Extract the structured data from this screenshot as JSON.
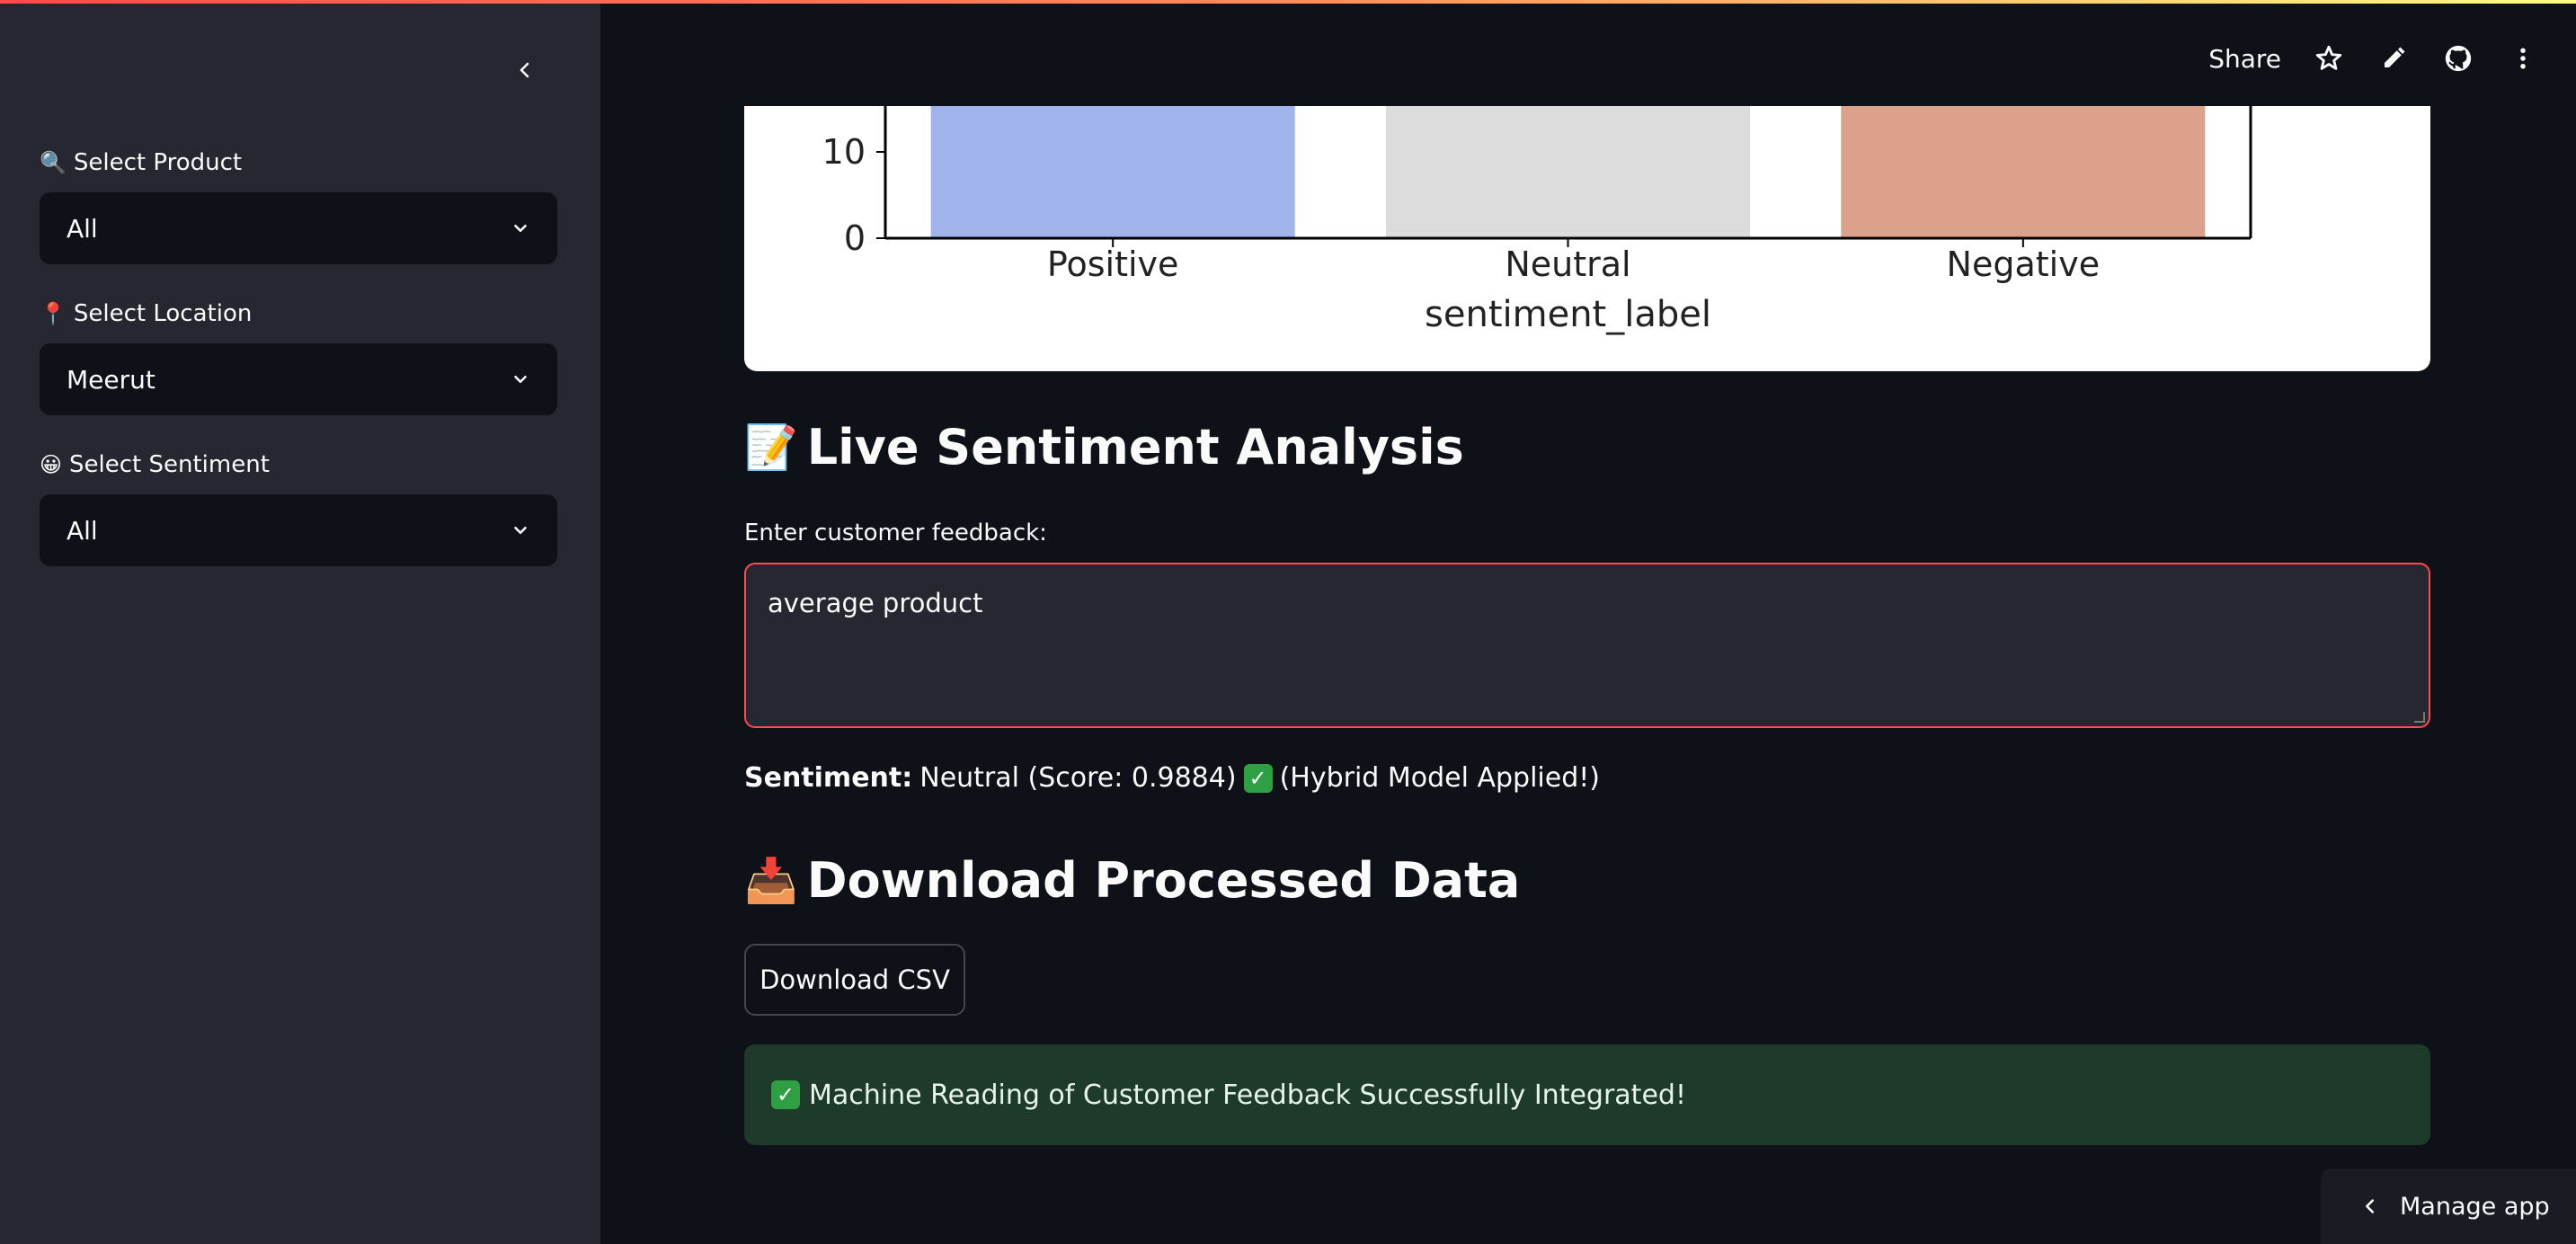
{
  "sidebar": {
    "filters": [
      {
        "label": "Select Product",
        "icon": "magnifier-icon",
        "emoji": "🔍",
        "value": "All"
      },
      {
        "label": "Select Location",
        "icon": "pin-icon",
        "emoji": "📍",
        "value": "Meerut"
      },
      {
        "label": "Select Sentiment",
        "icon": "smile-icon",
        "emoji": "😀",
        "value": "All"
      }
    ]
  },
  "header": {
    "share_label": "Share"
  },
  "chart_data": {
    "type": "bar",
    "categories": [
      "Positive",
      "Neutral",
      "Negative"
    ],
    "xlabel": "sentiment_label",
    "ylabel": "",
    "yticks": [
      0,
      10
    ],
    "colors": [
      "#a0b3ea",
      "#dcdcdc",
      "#dba18b"
    ],
    "note_visible_range": "y-axis cropped at top; bars extend above visible area"
  },
  "live": {
    "title": "Live Sentiment Analysis",
    "emoji": "📝",
    "input_label": "Enter customer feedback:",
    "input_value": "average product",
    "result_label": "Sentiment:",
    "result_text": "Neutral (Score: 0.9884)",
    "result_suffix": "(Hybrid Model Applied!)"
  },
  "download": {
    "title": "Download Processed Data",
    "emoji": "📥",
    "button_label": "Download CSV"
  },
  "success_message": "Machine Reading of Customer Feedback Successfully Integrated!",
  "footer": {
    "manage_label": "Manage app"
  },
  "colors": {
    "accent": "#ff4b4b",
    "sidebar_bg": "#262730",
    "main_bg": "#0e1117",
    "success_bg": "#1e3a2a"
  }
}
